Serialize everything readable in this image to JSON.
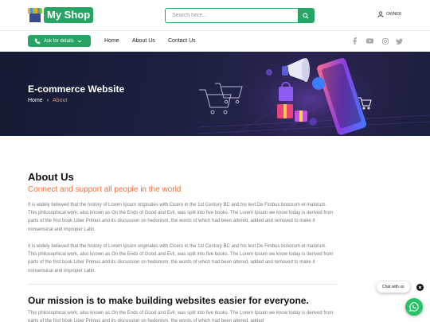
{
  "header": {
    "logo_text": "My Shop",
    "search_placeholder": "Search here...",
    "owner_label": "OWNER"
  },
  "nav": {
    "ask_button_label": "Ask for details",
    "links": [
      "Home",
      "About Us",
      "Contact Us"
    ],
    "social_icons": [
      "facebook-icon",
      "youtube-icon",
      "instagram-icon",
      "twitter-icon"
    ]
  },
  "hero": {
    "title": "E-commerce Website",
    "breadcrumb_home": "Home",
    "breadcrumb_current": "About"
  },
  "about": {
    "title": "About Us",
    "subtitle": "Connect and support all people in the world",
    "paragraph_1": "It is widely believed that the history of Lorem Ipsum originates with Cicero in the 1st Century BC and his text De Finibus bonorum et malorum. This philosophical work, also known as On the Ends of Good and Evil, was split into five books. The Lorem Ipsum we know today is derived from parts of the first book Liber Primus and its discussion on hedonism, the words of which had been altered, added and removed to make it nonsensical and improper Latin.",
    "paragraph_2": "It is widely believed that the history of Lorem Ipsum originates with Cicero in the 1st Century BC and his text De Finibus bonorum et malorum. This philosophical work, also known as On the Ends of Good and Evil, was split into five books. The Lorem Ipsum we know today is derived from parts of the first book Liber Primus and its discussion on hedonism, the words of which had been altered, added and removed to make it nonsensical and improper Latin."
  },
  "mission": {
    "title": "Our mission is to make building websites easier for everyone.",
    "paragraph": "This philosophical work, also known as On the Ends of Good and Evil, was split into five books. The Lorem Ipsum we know today is derived from parts of the first book Liber Primus and its discussion on hedonism, the words of which had been altered, added"
  },
  "chat": {
    "pill_label": "Chat with us"
  },
  "colors": {
    "brand_green": "#27a567",
    "accent_orange": "#f0713a",
    "hero_bg": "#1c2142",
    "whatsapp_green": "#27c365"
  }
}
